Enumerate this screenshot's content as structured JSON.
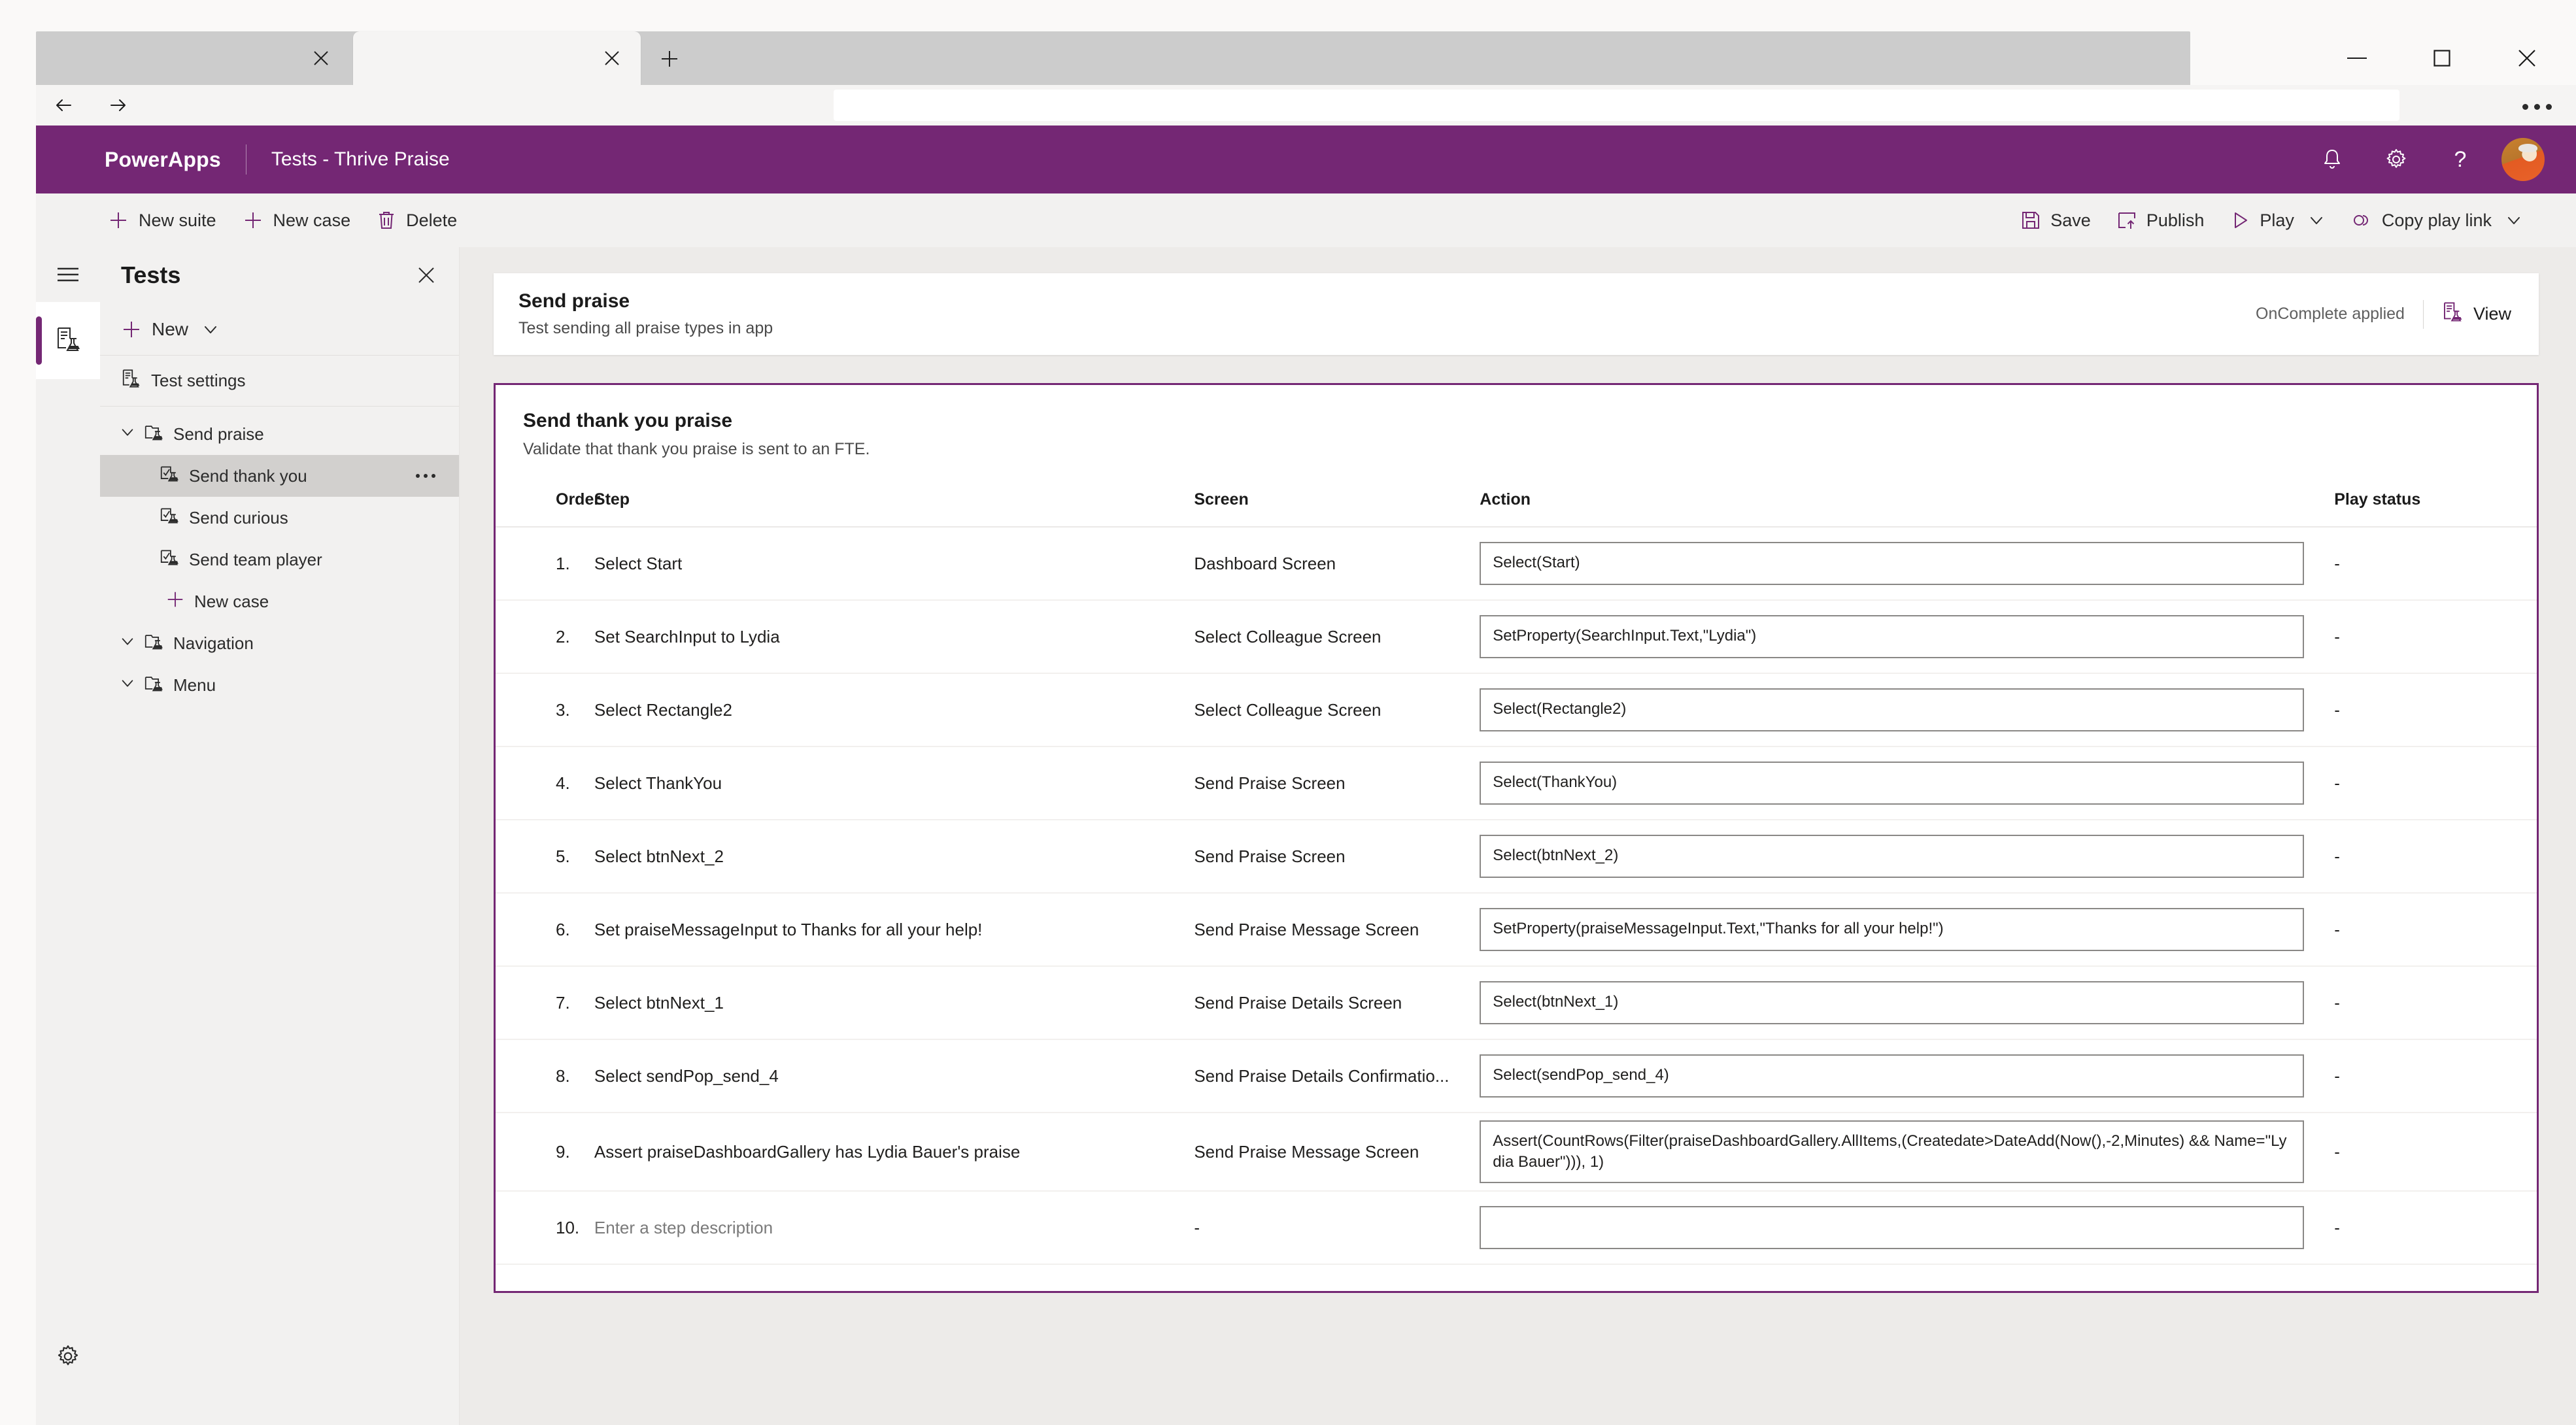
{
  "browser": {
    "tabs": [
      {
        "label": "",
        "active": false,
        "close_icon": "close-icon"
      },
      {
        "label": "",
        "active": true,
        "close_icon": "close-icon"
      }
    ],
    "new_tab_label": "+",
    "url_value": "",
    "url_placeholder": "",
    "more_label": "",
    "window_controls": {
      "minimize": "minimize-icon",
      "maximize": "maximize-icon",
      "close": "close-icon"
    }
  },
  "header": {
    "brand": "PowerApps",
    "title": "Tests - Thrive Praise",
    "icons": [
      "bell-icon",
      "gear-icon",
      "help-icon",
      "avatar"
    ]
  },
  "commandbar": {
    "left": [
      {
        "label": "New suite",
        "icon": "plus-icon"
      },
      {
        "label": "New case",
        "icon": "plus-icon"
      },
      {
        "label": "Delete",
        "icon": "trash-icon"
      }
    ],
    "right": [
      {
        "label": "Save",
        "icon": "save-icon",
        "caret": false
      },
      {
        "label": "Publish",
        "icon": "publish-icon",
        "caret": false
      },
      {
        "label": "Play",
        "icon": "play-icon",
        "caret": true
      },
      {
        "label": "Copy play link",
        "icon": "link-icon",
        "caret": true
      }
    ]
  },
  "rail": {
    "hamburger": "hamburger-icon",
    "test_icon": "test-flask-icon",
    "settings_icon": "gear-icon"
  },
  "tests_panel": {
    "title": "Tests",
    "close_label": "",
    "new_label": "New",
    "test_settings_label": "Test settings",
    "tree": [
      {
        "label": "Send praise",
        "level": 1,
        "icon": "suite-folder-icon",
        "expanded": true,
        "selected": false
      },
      {
        "label": "Send thank you",
        "level": 2,
        "icon": "test-case-icon",
        "selected": true,
        "overflow": true
      },
      {
        "label": "Send curious",
        "level": 2,
        "icon": "test-case-icon",
        "selected": false
      },
      {
        "label": "Send team player",
        "level": 2,
        "icon": "test-case-icon",
        "selected": false
      },
      {
        "label": "New case",
        "level": 2,
        "icon": "plus-icon",
        "selected": false,
        "is_new": true
      },
      {
        "label": "Navigation",
        "level": 1,
        "icon": "suite-folder-icon",
        "expanded": true,
        "selected": false
      },
      {
        "label": "Menu",
        "level": 1,
        "icon": "suite-folder-icon",
        "expanded": true,
        "selected": false
      }
    ]
  },
  "case_header": {
    "title": "Send praise",
    "subtitle": "Test sending all praise types in app",
    "status": "OnComplete applied",
    "view_label": "View",
    "view_icon": "test-flask-icon"
  },
  "case_card": {
    "title": "Send thank you praise",
    "subtitle": "Validate that thank you praise is sent to an FTE.",
    "columns": [
      "Order",
      "Step",
      "Screen",
      "Action",
      "Play status"
    ],
    "rows": [
      {
        "order": "1.",
        "step": "Select Start",
        "screen": "Dashboard Screen",
        "action": "Select(Start)",
        "status": "-"
      },
      {
        "order": "2.",
        "step": "Set SearchInput to Lydia",
        "screen": "Select Colleague Screen",
        "action": "SetProperty(SearchInput.Text,\"Lydia\")",
        "status": "-"
      },
      {
        "order": "3.",
        "step": "Select Rectangle2",
        "screen": "Select Colleague Screen",
        "action": "Select(Rectangle2)",
        "status": "-"
      },
      {
        "order": "4.",
        "step": "Select ThankYou",
        "screen": "Send Praise Screen",
        "action": "Select(ThankYou)",
        "status": "-"
      },
      {
        "order": "5.",
        "step": "Select btnNext_2",
        "screen": "Send Praise Screen",
        "action": "Select(btnNext_2)",
        "status": "-"
      },
      {
        "order": "6.",
        "step": "Set praiseMessageInput to Thanks for all your help!",
        "screen": "Send Praise Message Screen",
        "action": "SetProperty(praiseMessageInput.Text,\"Thanks for all your help!\")",
        "status": "-"
      },
      {
        "order": "7.",
        "step": "Select btnNext_1",
        "screen": "Send Praise Details Screen",
        "action": "Select(btnNext_1)",
        "status": "-"
      },
      {
        "order": "8.",
        "step": "Select sendPop_send_4",
        "screen": "Send Praise Details Confirmatio...",
        "action": "Select(sendPop_send_4)",
        "status": "-"
      },
      {
        "order": "9.",
        "step": "Assert praiseDashboardGallery has Lydia Bauer's praise",
        "screen": "Send Praise Message Screen",
        "action": "Assert(CountRows(Filter(praiseDashboardGallery.AllItems,(Createdate>DateAdd(Now(),-2,Minutes) && Name=\"Lydia Bauer\"))), 1)",
        "status": "-"
      },
      {
        "order": "10.",
        "step": "Enter a step description",
        "screen": "-",
        "action": "",
        "status": "-"
      }
    ]
  },
  "colors": {
    "brand_purple": "#742774",
    "command_bar_bg": "#f2f1f0",
    "main_bg": "#edebe9",
    "selection_gray": "#d2d0ce"
  }
}
